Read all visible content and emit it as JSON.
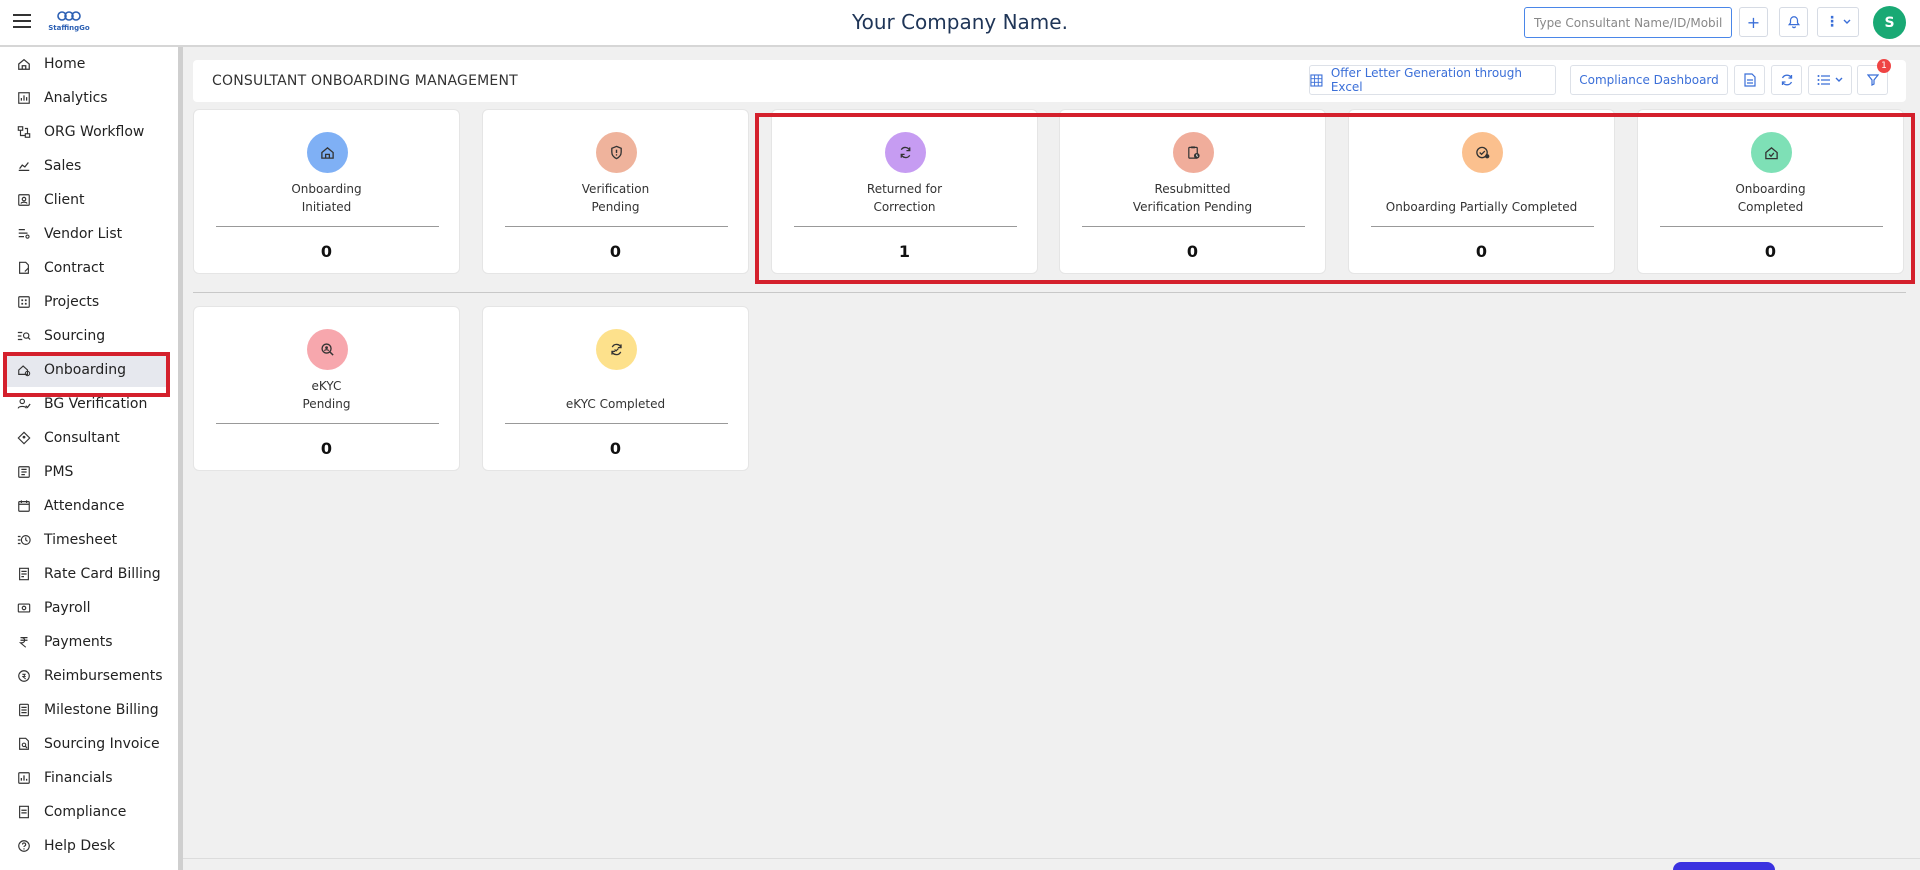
{
  "topbar": {
    "logo_text": "StaffingGo",
    "company_name": "Your Company Name.",
    "search_placeholder": "Type Consultant Name/ID/Mobile/...",
    "avatar_initial": "S"
  },
  "sidebar": {
    "items": [
      {
        "label": "Home",
        "icon": "home-icon"
      },
      {
        "label": "Analytics",
        "icon": "analytics-icon"
      },
      {
        "label": "ORG Workflow",
        "icon": "workflow-icon"
      },
      {
        "label": "Sales",
        "icon": "sales-icon"
      },
      {
        "label": "Client",
        "icon": "client-icon"
      },
      {
        "label": "Vendor List",
        "icon": "vendor-icon"
      },
      {
        "label": "Contract",
        "icon": "contract-icon"
      },
      {
        "label": "Projects",
        "icon": "projects-icon"
      },
      {
        "label": "Sourcing",
        "icon": "sourcing-icon"
      },
      {
        "label": "Onboarding",
        "icon": "onboarding-icon",
        "active": true
      },
      {
        "label": "BG Verification",
        "icon": "bg-verification-icon"
      },
      {
        "label": "Consultant",
        "icon": "consultant-icon"
      },
      {
        "label": "PMS",
        "icon": "pms-icon"
      },
      {
        "label": "Attendance",
        "icon": "attendance-icon"
      },
      {
        "label": "Timesheet",
        "icon": "timesheet-icon"
      },
      {
        "label": "Rate Card Billing",
        "icon": "rate-card-icon"
      },
      {
        "label": "Payroll",
        "icon": "payroll-icon"
      },
      {
        "label": "Payments",
        "icon": "rupee-icon"
      },
      {
        "label": "Reimbursements",
        "icon": "reimbursements-icon"
      },
      {
        "label": "Milestone Billing",
        "icon": "milestone-icon"
      },
      {
        "label": "Sourcing Invoice",
        "icon": "invoice-icon"
      },
      {
        "label": "Financials",
        "icon": "financials-icon"
      },
      {
        "label": "Compliance",
        "icon": "compliance-icon"
      },
      {
        "label": "Help Desk",
        "icon": "help-icon"
      }
    ]
  },
  "main": {
    "title": "CONSULTANT ONBOARDING MANAGEMENT",
    "offer_letter_label": "Offer Letter Generation through Excel",
    "compliance_label": "Compliance Dashboard",
    "filter_badge": "1",
    "cards": [
      {
        "line1": "Onboarding",
        "line2": "Initiated",
        "count": "0",
        "color": "#7fb0f5",
        "icon": "home-icon"
      },
      {
        "line1": "Verification",
        "line2": "Pending",
        "count": "0",
        "color": "#efb39c",
        "icon": "shield-icon"
      },
      {
        "line1": "Returned for",
        "line2": "Correction",
        "count": "1",
        "color": "#c69cf2",
        "icon": "refresh-icon"
      },
      {
        "line1": "Resubmitted",
        "line2": "Verification Pending",
        "count": "0",
        "color": "#f0ad9b",
        "icon": "clipboard-clock-icon"
      },
      {
        "line1": "Onboarding Partially Completed",
        "line2": "",
        "count": "0",
        "color": "#fbc08e",
        "icon": "check-clock-icon"
      },
      {
        "line1": "Onboarding",
        "line2": "Completed",
        "count": "0",
        "color": "#7ee0b6",
        "icon": "home-check-icon"
      },
      {
        "line1": "eKYC",
        "line2": "Pending",
        "count": "0",
        "color": "#f7a7ad",
        "icon": "search-user-icon"
      },
      {
        "line1": "eKYC Completed",
        "line2": "",
        "count": "0",
        "color": "#fde18c",
        "icon": "sync-check-icon"
      }
    ]
  }
}
